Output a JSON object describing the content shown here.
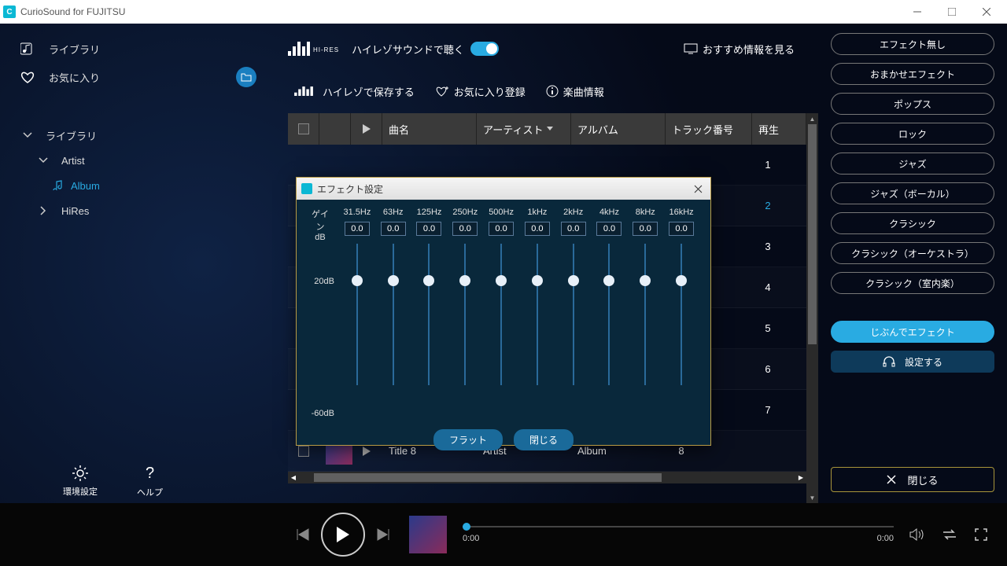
{
  "titlebar": {
    "title": "CurioSound for FUJITSU"
  },
  "sidebar": {
    "library": "ライブラリ",
    "favorites": "お気に入り",
    "tree": {
      "root": "ライブラリ",
      "artist": "Artist",
      "album": "Album",
      "hires": "HiRes"
    }
  },
  "content": {
    "hires_label": "HI-RES",
    "listen_hires": "ハイレゾサウンドで聴く",
    "recommended": "おすすめ情報を見る",
    "save_hires": "ハイレゾで保存する",
    "fav_register": "お気に入り登録",
    "track_info": "楽曲情報",
    "columns": {
      "title": "曲名",
      "artist": "アーティスト",
      "album": "アルバム",
      "trackno": "トラック番号",
      "play": "再生"
    },
    "rows": [
      {
        "no": "1"
      },
      {
        "no": "2"
      },
      {
        "no": "3"
      },
      {
        "no": "4"
      },
      {
        "no": "5"
      },
      {
        "no": "6"
      },
      {
        "no": "7"
      },
      {
        "title": "Title 8",
        "artist": "Artist",
        "album": "Album",
        "no": "8"
      }
    ]
  },
  "effects": {
    "none": "エフェクト無し",
    "auto": "おまかせエフェクト",
    "pops": "ポップス",
    "rock": "ロック",
    "jazz": "ジャズ",
    "jazz_vocal": "ジャズ（ボーカル）",
    "classic": "クラシック",
    "classic_orch": "クラシック（オーケストラ）",
    "classic_chamber": "クラシック（室内楽）",
    "custom": "じぶんでエフェクト",
    "settings": "設定する",
    "close": "閉じる"
  },
  "dialog": {
    "title": "エフェクト設定",
    "gain": "ゲイン",
    "db": "dB",
    "top": "20dB",
    "bottom": "-60dB",
    "bands": [
      {
        "freq": "31.5Hz",
        "val": "0.0"
      },
      {
        "freq": "63Hz",
        "val": "0.0"
      },
      {
        "freq": "125Hz",
        "val": "0.0"
      },
      {
        "freq": "250Hz",
        "val": "0.0"
      },
      {
        "freq": "500Hz",
        "val": "0.0"
      },
      {
        "freq": "1kHz",
        "val": "0.0"
      },
      {
        "freq": "2kHz",
        "val": "0.0"
      },
      {
        "freq": "4kHz",
        "val": "0.0"
      },
      {
        "freq": "8kHz",
        "val": "0.0"
      },
      {
        "freq": "16kHz",
        "val": "0.0"
      }
    ],
    "flat": "フラット",
    "close": "閉じる"
  },
  "footer": {
    "env_settings": "環境設定",
    "help": "ヘルプ",
    "time_cur": "0:00",
    "time_total": "0:00"
  }
}
